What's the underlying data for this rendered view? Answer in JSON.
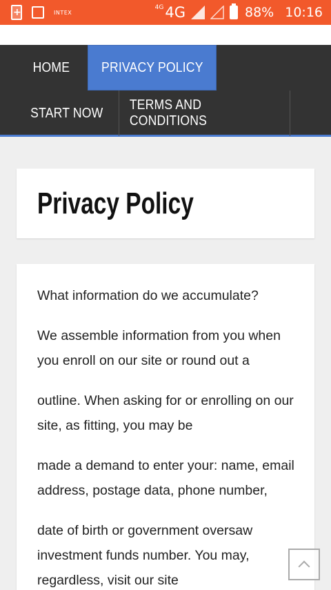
{
  "status_bar": {
    "brand": "INTEX",
    "network_small": "4G",
    "network": "4G",
    "battery_percent": "88%",
    "time": "10:16",
    "icons": [
      "battery-charging-icon",
      "image-icon",
      "signal-icon",
      "signal-empty-icon",
      "battery-icon"
    ]
  },
  "nav": {
    "items": [
      {
        "label": "HOME",
        "active": false
      },
      {
        "label": "PRIVACY POLICY",
        "active": true
      },
      {
        "label": "START NOW",
        "active": false
      },
      {
        "label": "TERMS AND CONDITIONS",
        "active": false
      }
    ],
    "accent": "#4a7bd0",
    "background": "#333333"
  },
  "page": {
    "title": "Privacy Policy",
    "paragraphs": [
      "What information do we accumulate?",
      "We assemble information from you when you enroll on our site or round out a",
      "outline. When asking for or enrolling on our site, as fitting, you may be",
      "made a demand to enter your: name, email address, postage data, phone number,",
      "date of birth or government oversaw investment funds number. You may, regardless, visit our site"
    ]
  },
  "colors": {
    "status_bar": "#f2592b",
    "page_background": "#efefef"
  }
}
